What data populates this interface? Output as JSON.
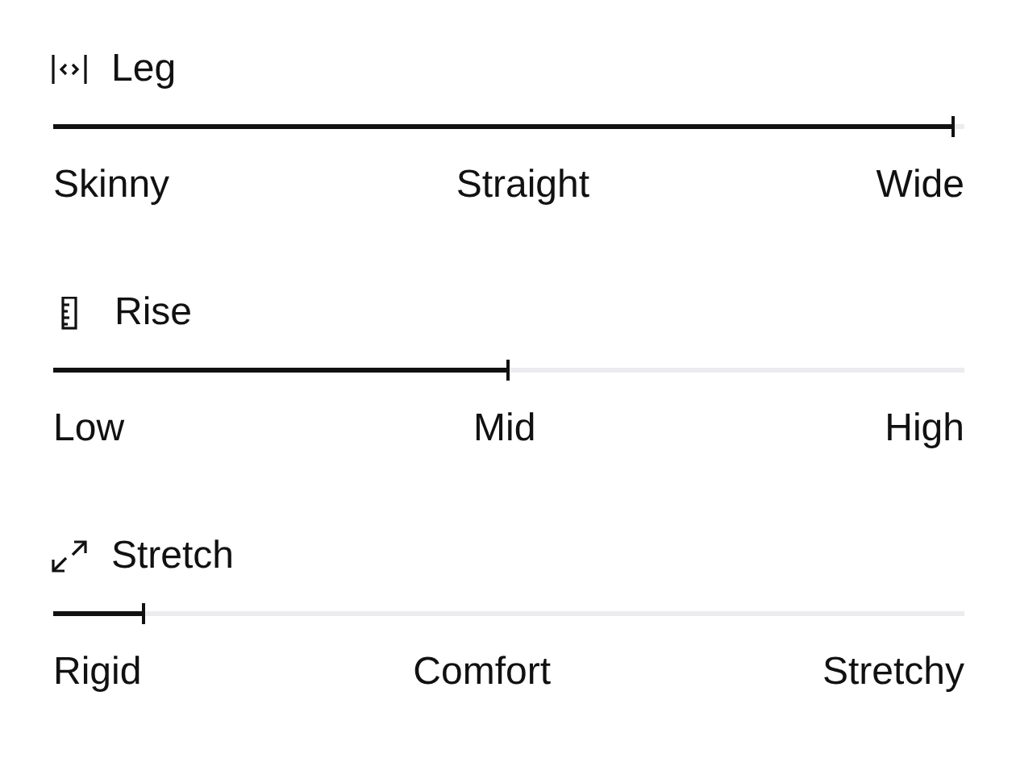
{
  "sliders": [
    {
      "kind": "width",
      "title": "Leg",
      "level": 0.99,
      "labels": [
        "Skinny",
        "Straight",
        "Wide"
      ]
    },
    {
      "kind": "ruler",
      "title": "Rise",
      "level": 0.5,
      "labels": [
        "Low",
        "Mid",
        "High"
      ]
    },
    {
      "kind": "expand",
      "title": "Stretch",
      "level": 0.1,
      "labels": [
        "Rigid",
        "Comfort",
        "Stretchy"
      ]
    }
  ]
}
